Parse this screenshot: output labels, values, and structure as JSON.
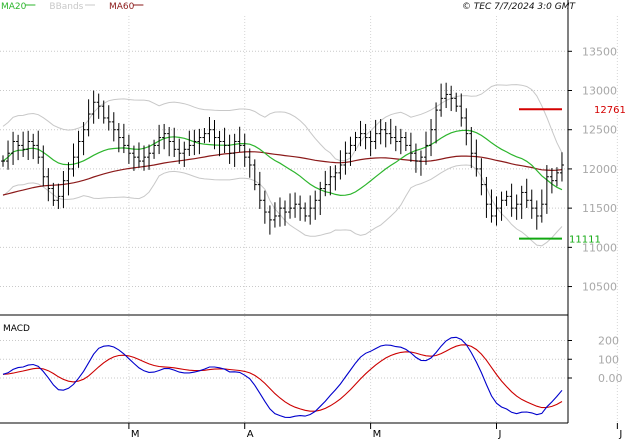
{
  "header": {
    "legend": [
      {
        "label": "MA20",
        "color": "#2db52d"
      },
      {
        "label": "BBands",
        "color": "#c8c8c8"
      },
      {
        "label": "MA60",
        "color": "#8b1a1a"
      }
    ],
    "stamp": "© TEC 7/7/2024 3:0 GMT"
  },
  "macd_label": "MACD",
  "chart_data": [
    {
      "type": "ohlc",
      "title": "",
      "ylim": [
        10150,
        13950
      ],
      "y_ticks": [
        {
          "value": 10500,
          "label": "10500"
        },
        {
          "value": 11000,
          "label": "11000"
        },
        {
          "value": 11500,
          "label": "11500"
        },
        {
          "value": 12000,
          "label": "12000"
        },
        {
          "value": 12500,
          "label": "12500"
        },
        {
          "value": 13000,
          "label": "13000"
        },
        {
          "value": 13500,
          "label": "13500"
        }
      ],
      "x_labels": [
        {
          "index": 25,
          "label": "M"
        },
        {
          "index": 48,
          "label": "A"
        },
        {
          "index": 73,
          "label": "M"
        },
        {
          "index": 98,
          "label": "J"
        },
        {
          "index": 122,
          "label": "J"
        }
      ],
      "closes": [
        12100,
        12200,
        12350,
        12300,
        12250,
        12350,
        12300,
        12150,
        11900,
        11750,
        11600,
        11650,
        11850,
        12000,
        12150,
        12350,
        12500,
        12700,
        12850,
        12800,
        12650,
        12600,
        12500,
        12400,
        12300,
        12200,
        12150,
        12100,
        12150,
        12200,
        12300,
        12400,
        12450,
        12350,
        12250,
        12200,
        12250,
        12300,
        12350,
        12400,
        12450,
        12500,
        12400,
        12350,
        12300,
        12200,
        12350,
        12300,
        12150,
        12050,
        11800,
        11600,
        11450,
        11350,
        11400,
        11500,
        11450,
        11500,
        11550,
        11500,
        11400,
        11500,
        11600,
        11750,
        11800,
        11900,
        11950,
        12050,
        12200,
        12300,
        12400,
        12450,
        12400,
        12350,
        12450,
        12500,
        12450,
        12400,
        12350,
        12400,
        12300,
        12200,
        12100,
        12150,
        12300,
        12500,
        12750,
        12900,
        12950,
        12900,
        12800,
        12650,
        12450,
        12200,
        12000,
        11800,
        11550,
        11400,
        11500,
        11600,
        11650,
        11500,
        11550,
        11700,
        11600,
        11500,
        11400,
        11550,
        11900,
        11850,
        11950,
        12050
      ],
      "bars_high_low_spread": 180,
      "series": [
        {
          "name": "MA20",
          "color": "#2db52d"
        },
        {
          "name": "BBands",
          "color": "#c8c8c8"
        },
        {
          "name": "MA60",
          "color": "#8b1a1a"
        }
      ],
      "levels": [
        {
          "value": 12761,
          "label": "12761",
          "color": "#d40000"
        },
        {
          "value": 11111,
          "label": "11111",
          "color": "#11a811"
        }
      ]
    },
    {
      "type": "line",
      "title": "MACD",
      "ylim": [
        -240,
        320
      ],
      "y_ticks": [
        {
          "value": 200,
          "label": "200"
        },
        {
          "value": 100,
          "label": "100"
        },
        {
          "value": 0,
          "label": "0.00"
        }
      ],
      "series": [
        {
          "name": "",
          "color": "#0000cc"
        },
        {
          "name": "",
          "color": "#cc0000"
        }
      ]
    }
  ]
}
